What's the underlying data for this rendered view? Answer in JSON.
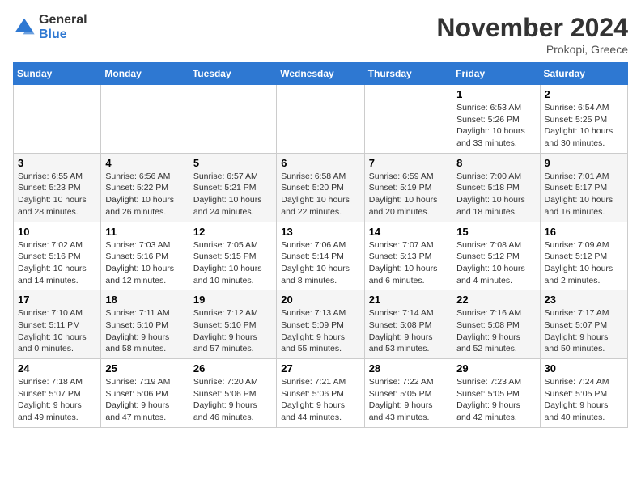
{
  "header": {
    "logo_general": "General",
    "logo_blue": "Blue",
    "month_title": "November 2024",
    "location": "Prokopi, Greece"
  },
  "weekdays": [
    "Sunday",
    "Monday",
    "Tuesday",
    "Wednesday",
    "Thursday",
    "Friday",
    "Saturday"
  ],
  "weeks": [
    [
      {
        "day": "",
        "info": ""
      },
      {
        "day": "",
        "info": ""
      },
      {
        "day": "",
        "info": ""
      },
      {
        "day": "",
        "info": ""
      },
      {
        "day": "",
        "info": ""
      },
      {
        "day": "1",
        "info": "Sunrise: 6:53 AM\nSunset: 5:26 PM\nDaylight: 10 hours and 33 minutes."
      },
      {
        "day": "2",
        "info": "Sunrise: 6:54 AM\nSunset: 5:25 PM\nDaylight: 10 hours and 30 minutes."
      }
    ],
    [
      {
        "day": "3",
        "info": "Sunrise: 6:55 AM\nSunset: 5:23 PM\nDaylight: 10 hours and 28 minutes."
      },
      {
        "day": "4",
        "info": "Sunrise: 6:56 AM\nSunset: 5:22 PM\nDaylight: 10 hours and 26 minutes."
      },
      {
        "day": "5",
        "info": "Sunrise: 6:57 AM\nSunset: 5:21 PM\nDaylight: 10 hours and 24 minutes."
      },
      {
        "day": "6",
        "info": "Sunrise: 6:58 AM\nSunset: 5:20 PM\nDaylight: 10 hours and 22 minutes."
      },
      {
        "day": "7",
        "info": "Sunrise: 6:59 AM\nSunset: 5:19 PM\nDaylight: 10 hours and 20 minutes."
      },
      {
        "day": "8",
        "info": "Sunrise: 7:00 AM\nSunset: 5:18 PM\nDaylight: 10 hours and 18 minutes."
      },
      {
        "day": "9",
        "info": "Sunrise: 7:01 AM\nSunset: 5:17 PM\nDaylight: 10 hours and 16 minutes."
      }
    ],
    [
      {
        "day": "10",
        "info": "Sunrise: 7:02 AM\nSunset: 5:16 PM\nDaylight: 10 hours and 14 minutes."
      },
      {
        "day": "11",
        "info": "Sunrise: 7:03 AM\nSunset: 5:16 PM\nDaylight: 10 hours and 12 minutes."
      },
      {
        "day": "12",
        "info": "Sunrise: 7:05 AM\nSunset: 5:15 PM\nDaylight: 10 hours and 10 minutes."
      },
      {
        "day": "13",
        "info": "Sunrise: 7:06 AM\nSunset: 5:14 PM\nDaylight: 10 hours and 8 minutes."
      },
      {
        "day": "14",
        "info": "Sunrise: 7:07 AM\nSunset: 5:13 PM\nDaylight: 10 hours and 6 minutes."
      },
      {
        "day": "15",
        "info": "Sunrise: 7:08 AM\nSunset: 5:12 PM\nDaylight: 10 hours and 4 minutes."
      },
      {
        "day": "16",
        "info": "Sunrise: 7:09 AM\nSunset: 5:12 PM\nDaylight: 10 hours and 2 minutes."
      }
    ],
    [
      {
        "day": "17",
        "info": "Sunrise: 7:10 AM\nSunset: 5:11 PM\nDaylight: 10 hours and 0 minutes."
      },
      {
        "day": "18",
        "info": "Sunrise: 7:11 AM\nSunset: 5:10 PM\nDaylight: 9 hours and 58 minutes."
      },
      {
        "day": "19",
        "info": "Sunrise: 7:12 AM\nSunset: 5:10 PM\nDaylight: 9 hours and 57 minutes."
      },
      {
        "day": "20",
        "info": "Sunrise: 7:13 AM\nSunset: 5:09 PM\nDaylight: 9 hours and 55 minutes."
      },
      {
        "day": "21",
        "info": "Sunrise: 7:14 AM\nSunset: 5:08 PM\nDaylight: 9 hours and 53 minutes."
      },
      {
        "day": "22",
        "info": "Sunrise: 7:16 AM\nSunset: 5:08 PM\nDaylight: 9 hours and 52 minutes."
      },
      {
        "day": "23",
        "info": "Sunrise: 7:17 AM\nSunset: 5:07 PM\nDaylight: 9 hours and 50 minutes."
      }
    ],
    [
      {
        "day": "24",
        "info": "Sunrise: 7:18 AM\nSunset: 5:07 PM\nDaylight: 9 hours and 49 minutes."
      },
      {
        "day": "25",
        "info": "Sunrise: 7:19 AM\nSunset: 5:06 PM\nDaylight: 9 hours and 47 minutes."
      },
      {
        "day": "26",
        "info": "Sunrise: 7:20 AM\nSunset: 5:06 PM\nDaylight: 9 hours and 46 minutes."
      },
      {
        "day": "27",
        "info": "Sunrise: 7:21 AM\nSunset: 5:06 PM\nDaylight: 9 hours and 44 minutes."
      },
      {
        "day": "28",
        "info": "Sunrise: 7:22 AM\nSunset: 5:05 PM\nDaylight: 9 hours and 43 minutes."
      },
      {
        "day": "29",
        "info": "Sunrise: 7:23 AM\nSunset: 5:05 PM\nDaylight: 9 hours and 42 minutes."
      },
      {
        "day": "30",
        "info": "Sunrise: 7:24 AM\nSunset: 5:05 PM\nDaylight: 9 hours and 40 minutes."
      }
    ]
  ]
}
